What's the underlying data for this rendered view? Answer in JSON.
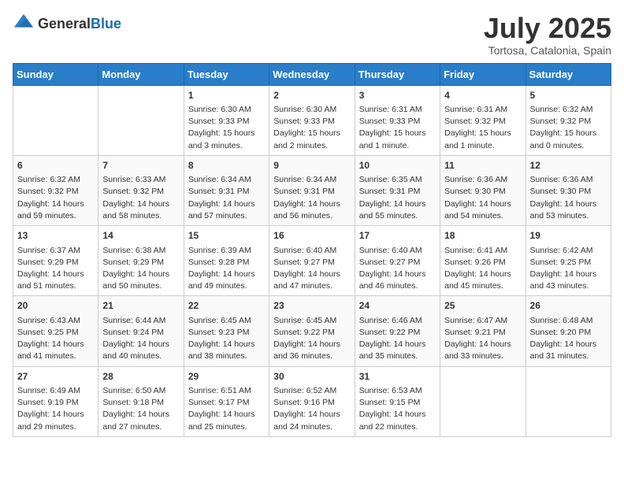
{
  "header": {
    "logo_general": "General",
    "logo_blue": "Blue",
    "month": "July 2025",
    "location": "Tortosa, Catalonia, Spain"
  },
  "days_of_week": [
    "Sunday",
    "Monday",
    "Tuesday",
    "Wednesday",
    "Thursday",
    "Friday",
    "Saturday"
  ],
  "weeks": [
    [
      {
        "day": "",
        "content": ""
      },
      {
        "day": "",
        "content": ""
      },
      {
        "day": "1",
        "content": "Sunrise: 6:30 AM\nSunset: 9:33 PM\nDaylight: 15 hours\nand 3 minutes."
      },
      {
        "day": "2",
        "content": "Sunrise: 6:30 AM\nSunset: 9:33 PM\nDaylight: 15 hours\nand 2 minutes."
      },
      {
        "day": "3",
        "content": "Sunrise: 6:31 AM\nSunset: 9:33 PM\nDaylight: 15 hours\nand 1 minute."
      },
      {
        "day": "4",
        "content": "Sunrise: 6:31 AM\nSunset: 9:32 PM\nDaylight: 15 hours\nand 1 minute."
      },
      {
        "day": "5",
        "content": "Sunrise: 6:32 AM\nSunset: 9:32 PM\nDaylight: 15 hours\nand 0 minutes."
      }
    ],
    [
      {
        "day": "6",
        "content": "Sunrise: 6:32 AM\nSunset: 9:32 PM\nDaylight: 14 hours\nand 59 minutes."
      },
      {
        "day": "7",
        "content": "Sunrise: 6:33 AM\nSunset: 9:32 PM\nDaylight: 14 hours\nand 58 minutes."
      },
      {
        "day": "8",
        "content": "Sunrise: 6:34 AM\nSunset: 9:31 PM\nDaylight: 14 hours\nand 57 minutes."
      },
      {
        "day": "9",
        "content": "Sunrise: 6:34 AM\nSunset: 9:31 PM\nDaylight: 14 hours\nand 56 minutes."
      },
      {
        "day": "10",
        "content": "Sunrise: 6:35 AM\nSunset: 9:31 PM\nDaylight: 14 hours\nand 55 minutes."
      },
      {
        "day": "11",
        "content": "Sunrise: 6:36 AM\nSunset: 9:30 PM\nDaylight: 14 hours\nand 54 minutes."
      },
      {
        "day": "12",
        "content": "Sunrise: 6:36 AM\nSunset: 9:30 PM\nDaylight: 14 hours\nand 53 minutes."
      }
    ],
    [
      {
        "day": "13",
        "content": "Sunrise: 6:37 AM\nSunset: 9:29 PM\nDaylight: 14 hours\nand 51 minutes."
      },
      {
        "day": "14",
        "content": "Sunrise: 6:38 AM\nSunset: 9:29 PM\nDaylight: 14 hours\nand 50 minutes."
      },
      {
        "day": "15",
        "content": "Sunrise: 6:39 AM\nSunset: 9:28 PM\nDaylight: 14 hours\nand 49 minutes."
      },
      {
        "day": "16",
        "content": "Sunrise: 6:40 AM\nSunset: 9:27 PM\nDaylight: 14 hours\nand 47 minutes."
      },
      {
        "day": "17",
        "content": "Sunrise: 6:40 AM\nSunset: 9:27 PM\nDaylight: 14 hours\nand 46 minutes."
      },
      {
        "day": "18",
        "content": "Sunrise: 6:41 AM\nSunset: 9:26 PM\nDaylight: 14 hours\nand 45 minutes."
      },
      {
        "day": "19",
        "content": "Sunrise: 6:42 AM\nSunset: 9:25 PM\nDaylight: 14 hours\nand 43 minutes."
      }
    ],
    [
      {
        "day": "20",
        "content": "Sunrise: 6:43 AM\nSunset: 9:25 PM\nDaylight: 14 hours\nand 41 minutes."
      },
      {
        "day": "21",
        "content": "Sunrise: 6:44 AM\nSunset: 9:24 PM\nDaylight: 14 hours\nand 40 minutes."
      },
      {
        "day": "22",
        "content": "Sunrise: 6:45 AM\nSunset: 9:23 PM\nDaylight: 14 hours\nand 38 minutes."
      },
      {
        "day": "23",
        "content": "Sunrise: 6:45 AM\nSunset: 9:22 PM\nDaylight: 14 hours\nand 36 minutes."
      },
      {
        "day": "24",
        "content": "Sunrise: 6:46 AM\nSunset: 9:22 PM\nDaylight: 14 hours\nand 35 minutes."
      },
      {
        "day": "25",
        "content": "Sunrise: 6:47 AM\nSunset: 9:21 PM\nDaylight: 14 hours\nand 33 minutes."
      },
      {
        "day": "26",
        "content": "Sunrise: 6:48 AM\nSunset: 9:20 PM\nDaylight: 14 hours\nand 31 minutes."
      }
    ],
    [
      {
        "day": "27",
        "content": "Sunrise: 6:49 AM\nSunset: 9:19 PM\nDaylight: 14 hours\nand 29 minutes."
      },
      {
        "day": "28",
        "content": "Sunrise: 6:50 AM\nSunset: 9:18 PM\nDaylight: 14 hours\nand 27 minutes."
      },
      {
        "day": "29",
        "content": "Sunrise: 6:51 AM\nSunset: 9:17 PM\nDaylight: 14 hours\nand 25 minutes."
      },
      {
        "day": "30",
        "content": "Sunrise: 6:52 AM\nSunset: 9:16 PM\nDaylight: 14 hours\nand 24 minutes."
      },
      {
        "day": "31",
        "content": "Sunrise: 6:53 AM\nSunset: 9:15 PM\nDaylight: 14 hours\nand 22 minutes."
      },
      {
        "day": "",
        "content": ""
      },
      {
        "day": "",
        "content": ""
      }
    ]
  ]
}
